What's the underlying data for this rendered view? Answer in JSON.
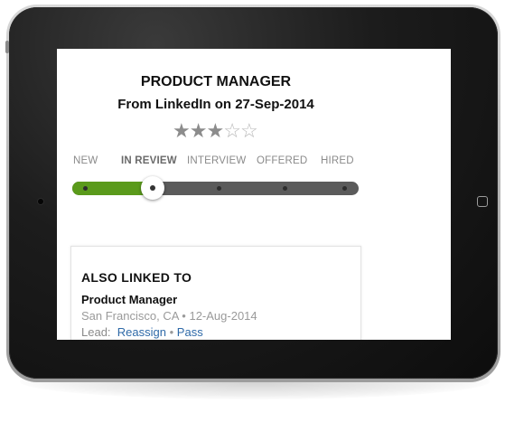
{
  "job": {
    "title": "PRODUCT MANAGER",
    "source_line": "From LinkedIn on 27-Sep-2014",
    "rating": {
      "filled": 3,
      "max": 5,
      "filled_glyph": "★",
      "empty_glyph": "☆"
    }
  },
  "pipeline": {
    "stages": [
      "NEW",
      "IN REVIEW",
      "INTERVIEW",
      "OFFERED",
      "HIRED"
    ],
    "current_stage": "IN REVIEW",
    "progress_fraction": 0.28,
    "colors": {
      "progress": "#5a9a1b",
      "track": "#5b5b5b"
    }
  },
  "also_linked": {
    "heading": "ALSO LINKED TO",
    "job_title": "Product Manager",
    "location": "San Francisco, CA",
    "bullet": "•",
    "date": "12-Aug-2014",
    "lead_label": "Lead:",
    "reassign_label": "Reassign",
    "separator": "•",
    "pass_label": "Pass",
    "link_color": "#2f6aa8"
  },
  "device": {
    "icons": [
      "camera-icon",
      "home-button-icon"
    ]
  }
}
